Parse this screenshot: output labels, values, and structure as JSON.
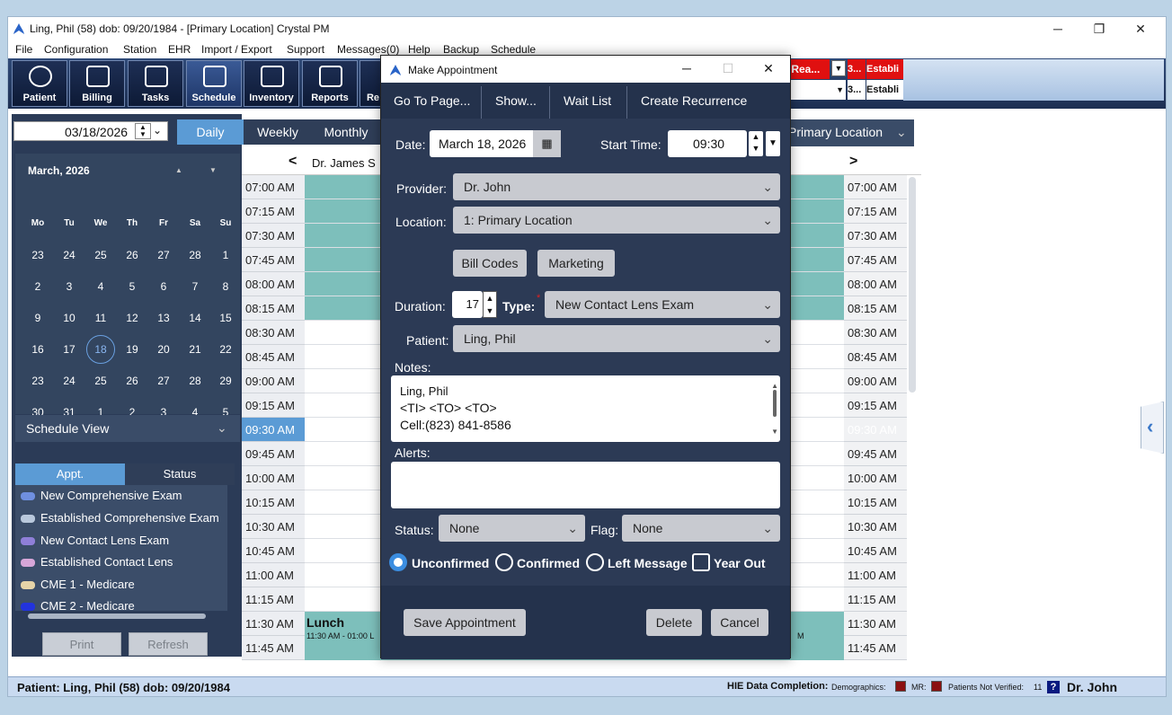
{
  "window": {
    "title": "Ling, Phil (58) dob: 09/20/1984 - [Primary Location] Crystal PM",
    "minimize": "─",
    "restore": "❐",
    "close": "✕"
  },
  "menu": [
    "File",
    "Configuration",
    "Station",
    "EHR",
    "Import / Export",
    "Support",
    "Messages(0)",
    "Help",
    "Backup",
    "Schedule"
  ],
  "toolbar": [
    "Patient",
    "Billing",
    "Tasks",
    "Schedule",
    "Inventory",
    "Reports",
    "Re"
  ],
  "header_cells": {
    "row1_a": "- Rea...",
    "row1_b": "3...",
    "row1_c": "Establi",
    "row2_b": "3...",
    "row2_c": "Establi"
  },
  "date_picker": {
    "value": "03/18/2026"
  },
  "view_tabs": {
    "daily": "Daily",
    "weekly": "Weekly",
    "monthly": "Monthly"
  },
  "location_select": "Primary Location",
  "calendar": {
    "month": "March, 2026",
    "headers": [
      "Mo",
      "Tu",
      "We",
      "Th",
      "Fr",
      "Sa",
      "Su"
    ],
    "weeks": [
      [
        "23",
        "24",
        "25",
        "26",
        "27",
        "28",
        "1"
      ],
      [
        "2",
        "3",
        "4",
        "5",
        "6",
        "7",
        "8"
      ],
      [
        "9",
        "10",
        "11",
        "12",
        "13",
        "14",
        "15"
      ],
      [
        "16",
        "17",
        "18",
        "19",
        "20",
        "21",
        "22"
      ],
      [
        "23",
        "24",
        "25",
        "26",
        "27",
        "28",
        "29"
      ],
      [
        "30",
        "31",
        "1",
        "2",
        "3",
        "4",
        "5"
      ]
    ],
    "selected": "18"
  },
  "schedule_view": "Schedule View",
  "legend_tabs": {
    "appt": "Appt.",
    "status": "Status"
  },
  "legend": [
    {
      "label": "New Comprehensive Exam",
      "color": "#6f8fe0"
    },
    {
      "label": "Established Comprehensive Exam",
      "color": "#b9c8dc"
    },
    {
      "label": "New Contact Lens Exam",
      "color": "#8f7fd8"
    },
    {
      "label": "Established Contact Lens",
      "color": "#d7a6d8"
    },
    {
      "label": "CME 1 - Medicare",
      "color": "#e6d4a8"
    },
    {
      "label": "CME 2 - Medicare",
      "color": "#2233dd"
    }
  ],
  "left_buttons": {
    "print": "Print",
    "refresh": "Refresh"
  },
  "schedule": {
    "provider_header": "Dr. James S",
    "prev": "<",
    "next": ">",
    "times": [
      "07:00 AM",
      "07:15 AM",
      "07:30 AM",
      "07:45 AM",
      "08:00 AM",
      "08:15 AM",
      "08:30 AM",
      "08:45 AM",
      "09:00 AM",
      "09:15 AM",
      "09:30 AM",
      "09:45 AM",
      "10:00 AM",
      "10:15 AM",
      "10:30 AM",
      "10:45 AM",
      "11:00 AM",
      "11:15 AM",
      "11:30 AM",
      "11:45 AM"
    ],
    "highlight_time": "09:30 AM",
    "lunch_title": "Lunch",
    "lunch_sub": "11:30 AM - 01:00 L",
    "lunch_right": "M"
  },
  "statusbar": {
    "patient": "Patient: Ling, Phil (58) dob: 09/20/1984",
    "hie": "HIE Data Completion:",
    "demographics": "Demographics:",
    "mr": "MR:",
    "not_verified": "Patients Not Verified:",
    "not_verified_count": "11",
    "help": "?",
    "user": "Dr. John"
  },
  "dialog": {
    "title": "Make Appointment",
    "menu": [
      "Go To Page...",
      "Show...",
      "Wait List",
      "Create Recurrence"
    ],
    "date_label": "Date:",
    "date_value": "March 18, 2026",
    "start_label": "Start Time:",
    "start_value": "09:30",
    "provider_label": "Provider:",
    "provider_value": "Dr. John",
    "location_label": "Location:",
    "location_value": "1: Primary Location",
    "bill_codes": "Bill Codes",
    "marketing": "Marketing",
    "duration_label": "Duration:",
    "duration_value": "17",
    "type_label": "Type:",
    "type_required": "*",
    "type_value": "New Contact Lens Exam",
    "patient_label": "Patient:",
    "patient_value": "Ling, Phil",
    "notes_label": "Notes:",
    "notes_lines": [
      "Ling, Phil",
      "<TI> <TO> <TO>",
      "Cell:(823) 841-8586"
    ],
    "alerts_label": "Alerts:",
    "status_label": "Status:",
    "status_value": "None",
    "flag_label": "Flag:",
    "flag_value": "None",
    "radios": {
      "unconfirmed": "Unconfirmed",
      "confirmed": "Confirmed",
      "left_message": "Left Message",
      "year_out": "Year Out"
    },
    "save": "Save Appointment",
    "delete": "Delete",
    "cancel": "Cancel"
  }
}
